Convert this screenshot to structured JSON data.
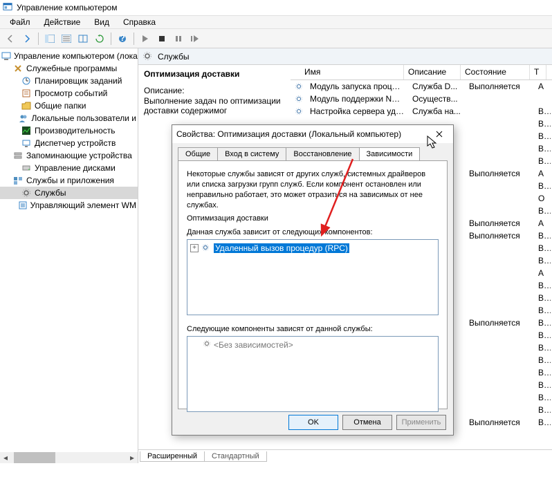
{
  "window": {
    "title": "Управление компьютером"
  },
  "menu": {
    "file": "Файл",
    "action": "Действие",
    "view": "Вид",
    "help": "Справка"
  },
  "tree": {
    "root": "Управление компьютером (локаль",
    "n_tools": "Служебные программы",
    "n_sched": "Планировщик заданий",
    "n_event": "Просмотр событий",
    "n_shared": "Общие папки",
    "n_users": "Локальные пользователи и",
    "n_perf": "Производительность",
    "n_devmgr": "Диспетчер устройств",
    "n_storage": "Запоминающие устройства",
    "n_disk": "Управление дисками",
    "n_apps": "Службы и приложения",
    "n_services": "Службы",
    "n_wmi": "Управляющий элемент WM"
  },
  "content": {
    "header": "Службы",
    "desc_title": "Оптимизация доставки",
    "desc_label": "Описание:",
    "desc_text": "Выполнение задач по оптимизации доставки содержимог",
    "columns": {
      "name": "Имя",
      "desc": "Описание",
      "state": "Состояние",
      "type": "Т"
    },
    "rows": [
      {
        "name": "Модуль запуска процессо...",
        "desc": "Служба D...",
        "state": "Выполняется",
        "type": "А"
      },
      {
        "name": "Модуль поддержки NetBI...",
        "desc": "Осуществ...",
        "state": "",
        "type": ""
      },
      {
        "name": "Настройка сервера удален...",
        "desc": "Служба на...",
        "state": "",
        "type": "Вр"
      },
      {
        "name": "",
        "desc": "",
        "state": "",
        "type": "Вр"
      },
      {
        "name": "",
        "desc": "",
        "state": "",
        "type": "Вр"
      },
      {
        "name": "",
        "desc": "",
        "state": "",
        "type": "Вр"
      },
      {
        "name": "",
        "desc": "",
        "state": "",
        "type": "Вр"
      },
      {
        "name": "",
        "desc": "",
        "state": "Выполняется",
        "type": "А"
      },
      {
        "name": "",
        "desc": "",
        "state": "",
        "type": "Вр"
      },
      {
        "name": "",
        "desc": "",
        "state": "",
        "type": "О"
      },
      {
        "name": "",
        "desc": "",
        "state": "",
        "type": "Вр"
      },
      {
        "name": "",
        "desc": "",
        "state": "Выполняется",
        "type": "А"
      },
      {
        "name": "",
        "desc": "",
        "state": "Выполняется",
        "type": "Вр"
      },
      {
        "name": "",
        "desc": "",
        "state": "",
        "type": "Вр"
      },
      {
        "name": "",
        "desc": "",
        "state": "",
        "type": "Вр"
      },
      {
        "name": "",
        "desc": "",
        "state": "",
        "type": "А"
      },
      {
        "name": "",
        "desc": "",
        "state": "",
        "type": "Вр"
      },
      {
        "name": "",
        "desc": "",
        "state": "",
        "type": "Вр"
      },
      {
        "name": "",
        "desc": "",
        "state": "",
        "type": "Вр"
      },
      {
        "name": "",
        "desc": "",
        "state": "Выполняется",
        "type": "Вр"
      },
      {
        "name": "",
        "desc": "",
        "state": "",
        "type": "Вр"
      },
      {
        "name": "",
        "desc": "",
        "state": "",
        "type": "Вр"
      },
      {
        "name": "",
        "desc": "",
        "state": "",
        "type": "Вр"
      },
      {
        "name": "",
        "desc": "",
        "state": "",
        "type": "Вр"
      },
      {
        "name": "",
        "desc": "",
        "state": "",
        "type": "Вр"
      },
      {
        "name": "",
        "desc": "",
        "state": "",
        "type": "Вр"
      },
      {
        "name": "",
        "desc": "",
        "state": "",
        "type": "Вр"
      },
      {
        "name": "",
        "desc": "",
        "state": "Выполняется",
        "type": "Вр"
      }
    ],
    "tabs": {
      "extended": "Расширенный",
      "standard": "Стандартный"
    }
  },
  "dialog": {
    "title": "Свойства: Оптимизация доставки (Локальный компьютер)",
    "tabs": {
      "general": "Общие",
      "logon": "Вход в систему",
      "recovery": "Восстановление",
      "deps": "Зависимости"
    },
    "para": "Некоторые службы зависят от других служб, системных драйверов или списка загрузки групп служб. Если компонент остановлен или неправильно работает, это может отразиться на зависимых от нее службах.",
    "svc_name": "Оптимизация доставки",
    "section1": "Данная служба зависит от следующих компонентов:",
    "dep_item": "Удаленный вызов процедур (RPC)",
    "section2": "Следующие компоненты зависят от данной службы:",
    "no_deps": "<Без зависимостей>",
    "btn_ok": "OK",
    "btn_cancel": "Отмена",
    "btn_apply": "Применить"
  }
}
